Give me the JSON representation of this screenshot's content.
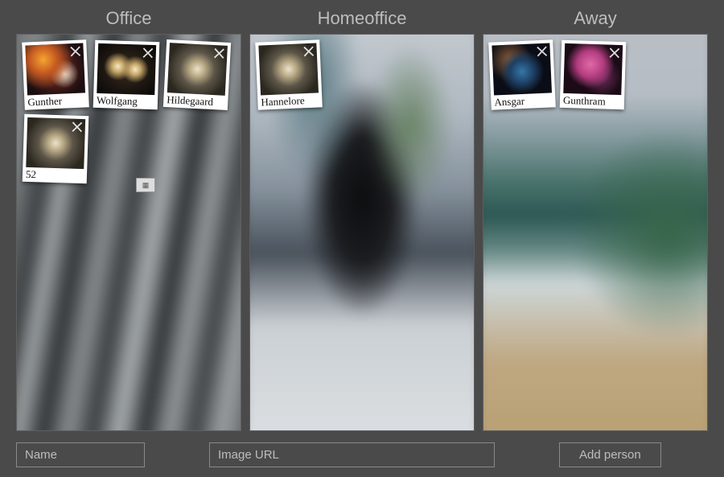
{
  "boards": [
    {
      "title": "Office",
      "bg": "bg-office",
      "cards": [
        {
          "name": "Gunther",
          "thumb": "th-orange"
        },
        {
          "name": "Wolfgang",
          "thumb": "th-eyes"
        },
        {
          "name": "Hildegaard",
          "thumb": "th-spiral"
        },
        {
          "name": "52",
          "thumb": "th-spiral"
        }
      ]
    },
    {
      "title": "Homeoffice",
      "bg": "bg-home",
      "cards": [
        {
          "name": "Hannelore",
          "thumb": "th-spiral"
        }
      ]
    },
    {
      "title": "Away",
      "bg": "bg-away",
      "cards": [
        {
          "name": "Ansgar",
          "thumb": "th-blueneb"
        },
        {
          "name": "Gunthram",
          "thumb": "th-pink"
        }
      ]
    }
  ],
  "form": {
    "name_placeholder": "Name",
    "url_placeholder": "Image URL",
    "submit_label": "Add person"
  }
}
